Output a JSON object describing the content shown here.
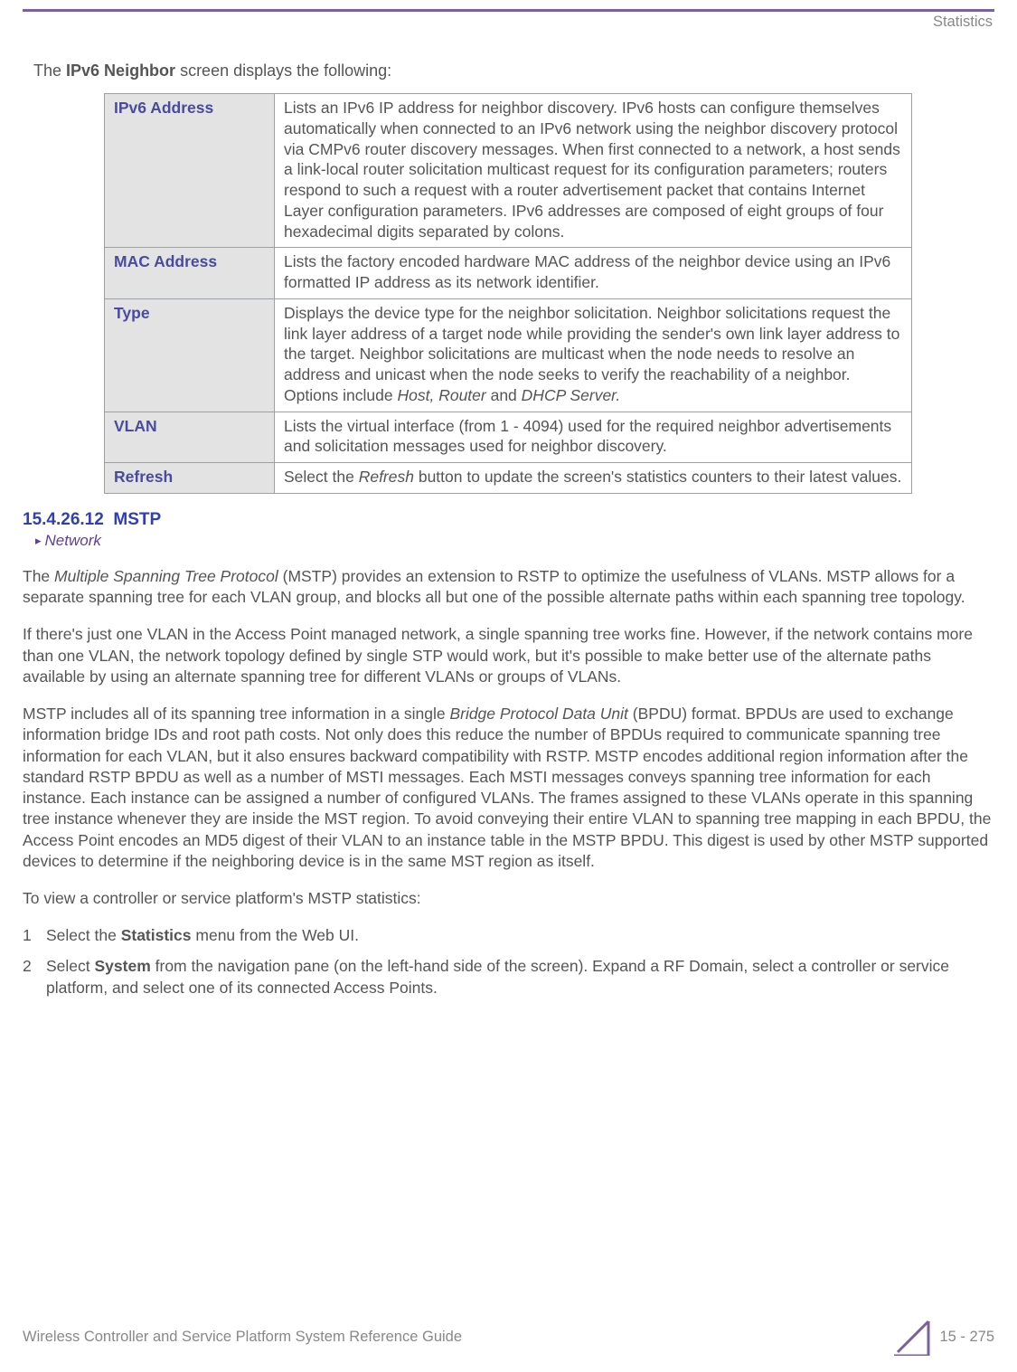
{
  "header": {
    "section": "Statistics"
  },
  "intro": {
    "prefix": "The ",
    "bold": "IPv6 Neighbor",
    "suffix": " screen displays the following:"
  },
  "table": {
    "rows": [
      {
        "label": "IPv6 Address",
        "desc": "Lists an IPv6 IP address for neighbor discovery. IPv6 hosts can configure themselves automatically when connected to an IPv6 network using the neighbor discovery protocol via CMPv6 router discovery messages. When first connected to a network, a host sends a link-local router solicitation multicast request for its configuration parameters; routers respond to such a request with a router advertisement packet that contains Internet Layer configuration parameters. IPv6 addresses are composed of eight groups of four hexadecimal digits separated by colons."
      },
      {
        "label": "MAC Address",
        "desc": "Lists the factory encoded hardware MAC address of the neighbor device using an IPv6 formatted IP address as its network identifier."
      },
      {
        "label": "Type",
        "desc_pre": "Displays the device type for the neighbor solicitation. Neighbor solicitations request the link layer address of a target node while providing the sender's own link layer address to the target. Neighbor solicitations are multicast when the node needs to resolve an address and unicast when the node seeks to verify the reachability of a neighbor. Options include ",
        "desc_em1": "Host, Router",
        "desc_mid": " and ",
        "desc_em2": "DHCP Server."
      },
      {
        "label": "VLAN",
        "desc": "Lists the virtual interface (from 1 - 4094) used for the required neighbor advertisements and solicitation messages used for neighbor discovery."
      },
      {
        "label": "Refresh",
        "desc_pre": "Select the ",
        "desc_em1": "Refresh",
        "desc_post": " button to update the screen's statistics counters to their latest values."
      }
    ]
  },
  "section": {
    "number": "15.4.26.12",
    "title": "MSTP",
    "breadcrumb": "Network"
  },
  "paragraphs": {
    "p1_pre": "The ",
    "p1_em": "Multiple Spanning Tree Protocol",
    "p1_post": " (MSTP) provides an extension to RSTP to optimize the usefulness of VLANs. MSTP allows for a separate spanning tree for each VLAN group, and blocks all but one of the possible alternate paths within each spanning tree topology.",
    "p2": "If there's just one VLAN in the Access Point managed network, a single spanning tree works fine. However, if the network contains more than one VLAN, the network topology defined by single STP would work, but it's possible to make better use of the alternate paths available by using an alternate spanning tree for different VLANs or groups of VLANs.",
    "p3_pre": "MSTP includes all of its spanning tree information in a single ",
    "p3_em": "Bridge Protocol Data Unit",
    "p3_post": " (BPDU) format. BPDUs are used to exchange information bridge IDs and root path costs. Not only does this reduce the number of BPDUs required to communicate spanning tree information for each VLAN, but it also ensures backward compatibility with RSTP. MSTP encodes additional region information after the standard RSTP BPDU as well as a number of MSTI messages. Each MSTI messages conveys spanning tree information for each instance. Each instance can be assigned a number of configured VLANs. The frames assigned to these VLANs operate in this spanning tree instance whenever they are inside the MST region. To avoid conveying their entire VLAN to spanning tree mapping in each BPDU, the Access Point encodes an MD5 digest of their VLAN to an instance table in the MSTP BPDU. This digest is used by other MSTP supported devices to determine if the neighboring device is in the same MST region as itself.",
    "p4": "To view a controller or service platform's MSTP statistics:"
  },
  "steps": {
    "s1_pre": "Select the ",
    "s1_bold": "Statistics",
    "s1_post": " menu from the Web UI.",
    "s2_pre": "Select ",
    "s2_bold": "System",
    "s2_post": " from the navigation pane (on the left-hand side of the screen). Expand a RF Domain, select a controller or service platform, and select one of its connected Access Points."
  },
  "footer": {
    "guide": "Wireless Controller and Service Platform System Reference Guide",
    "page": "15 - 275"
  }
}
